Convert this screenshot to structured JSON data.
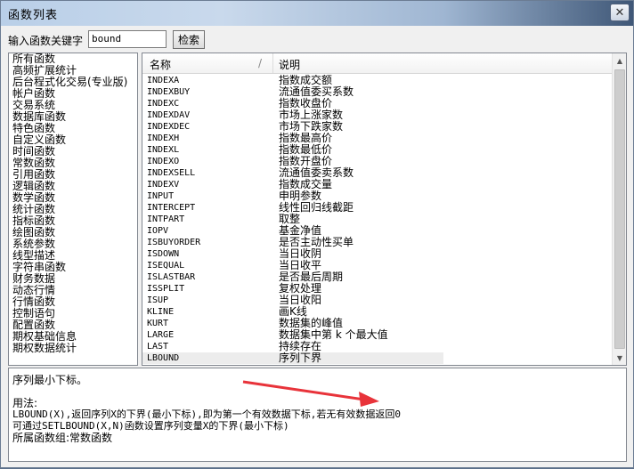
{
  "window": {
    "title": "函数列表",
    "close_glyph": "✕"
  },
  "search": {
    "label": "输入函数关键字",
    "value": "bound",
    "button_label": "检索"
  },
  "categories": [
    "所有函数",
    "高频扩展统计",
    "后台程式化交易(专业版)",
    "帐户函数",
    "交易系统",
    "数据库函数",
    "特色函数",
    "自定义函数",
    "时间函数",
    "常数函数",
    "引用函数",
    "逻辑函数",
    "数学函数",
    "统计函数",
    "指标函数",
    "绘图函数",
    "系统参数",
    "线型描述",
    "字符串函数",
    "财务数据",
    "动态行情",
    "行情函数",
    "控制语句",
    "配置函数",
    "期权基础信息",
    "期权数据统计"
  ],
  "function_table": {
    "col_name": "名称",
    "col_desc": "说明",
    "sort_mark": "/",
    "rows": [
      {
        "name": "INDEXA",
        "desc": "指数成交额"
      },
      {
        "name": "INDEXBUY",
        "desc": "流通值委买系数"
      },
      {
        "name": "INDEXC",
        "desc": "指数收盘价"
      },
      {
        "name": "INDEXDAV",
        "desc": "市场上涨家数"
      },
      {
        "name": "INDEXDEC",
        "desc": "市场下跌家数"
      },
      {
        "name": "INDEXH",
        "desc": "指数最高价"
      },
      {
        "name": "INDEXL",
        "desc": "指数最低价"
      },
      {
        "name": "INDEXO",
        "desc": "指数开盘价"
      },
      {
        "name": "INDEXSELL",
        "desc": "流通值委卖系数"
      },
      {
        "name": "INDEXV",
        "desc": "指数成交量"
      },
      {
        "name": "INPUT",
        "desc": "申明参数"
      },
      {
        "name": "INTERCEPT",
        "desc": "线性回归线截距"
      },
      {
        "name": "INTPART",
        "desc": "取整"
      },
      {
        "name": "IOPV",
        "desc": "基金净值"
      },
      {
        "name": "ISBUYORDER",
        "desc": "是否主动性买单"
      },
      {
        "name": "ISDOWN",
        "desc": "当日收阴"
      },
      {
        "name": "ISEQUAL",
        "desc": "当日收平"
      },
      {
        "name": "ISLASTBAR",
        "desc": "是否最后周期"
      },
      {
        "name": "ISSPLIT",
        "desc": "复权处理"
      },
      {
        "name": "ISUP",
        "desc": "当日收阳"
      },
      {
        "name": "KLINE",
        "desc": "画K线"
      },
      {
        "name": "KURT",
        "desc": "数据集的峰值"
      },
      {
        "name": "LARGE",
        "desc": "数据集中第 k 个最大值"
      },
      {
        "name": "LAST",
        "desc": "持续存在"
      },
      {
        "name": "LBOUND",
        "desc": "序列下界"
      }
    ],
    "selected_index": 24
  },
  "help": {
    "summary": "序列最小下标。",
    "usage_label": "用法:",
    "usage_line1": "LBOUND(X),返回序列X的下界(最小下标),即为第一个有效数据下标,若无有效数据返回0",
    "usage_line2": "可通过SETLBOUND(X,N)函数设置序列变量X的下界(最小下标)",
    "group": "所属函数组:常数函数"
  },
  "colors": {
    "annotation_arrow": "#e8333a",
    "selected_row": "#ececec"
  }
}
